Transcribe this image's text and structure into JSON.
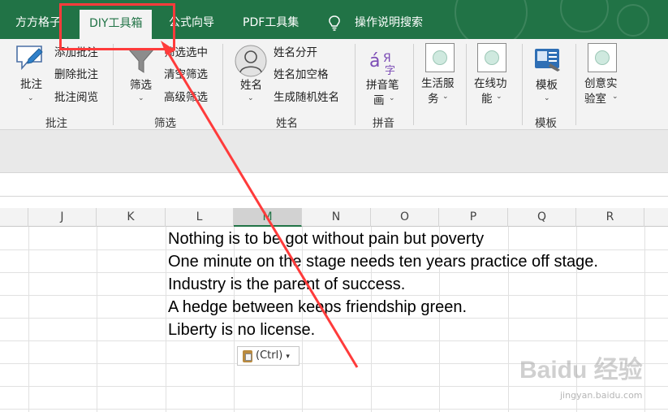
{
  "tabs": [
    {
      "label": "方方格子"
    },
    {
      "label": "DIY工具箱"
    },
    {
      "label": "公式向导"
    },
    {
      "label": "PDF工具集"
    },
    {
      "label": "操作说明搜索"
    }
  ],
  "ribbon": {
    "comments": {
      "main_label": "批注",
      "items": [
        "添加批注",
        "删除批注",
        "批注阅览"
      ],
      "group_label": "批注"
    },
    "filter": {
      "main_label": "筛选",
      "items": [
        "筛选选中",
        "清空筛选",
        "高级筛选"
      ],
      "group_label": "筛选"
    },
    "name": {
      "main_label": "姓名",
      "items": [
        "姓名分开",
        "姓名加空格",
        "生成随机姓名"
      ],
      "group_label": "姓名"
    },
    "pinyin": {
      "main_label_1": "拼音笔",
      "main_label_2": "画",
      "group_label": "拼音"
    },
    "life": {
      "label_1": "生活服",
      "label_2": "务"
    },
    "online": {
      "label_1": "在线功",
      "label_2": "能"
    },
    "template": {
      "label": "模板",
      "group_label": "模板"
    },
    "lab": {
      "label_1": "创意实",
      "label_2": "验室"
    }
  },
  "columns": [
    "J",
    "K",
    "L",
    "M",
    "N",
    "O",
    "P",
    "Q",
    "R"
  ],
  "cells": [
    "Nothing is to be got without pain but poverty",
    "One minute on the stage needs ten years practice off stage.",
    "Industry is the parent of success.",
    "A hedge between keeps friendship green.",
    "Liberty is no license."
  ],
  "paste_options": "(Ctrl)",
  "watermark": {
    "line1": "Baidu 经验",
    "line2": "jingyan.baidu.com"
  },
  "colors": {
    "excel_green": "#217346",
    "annotation_red": "#ff3b3b"
  }
}
